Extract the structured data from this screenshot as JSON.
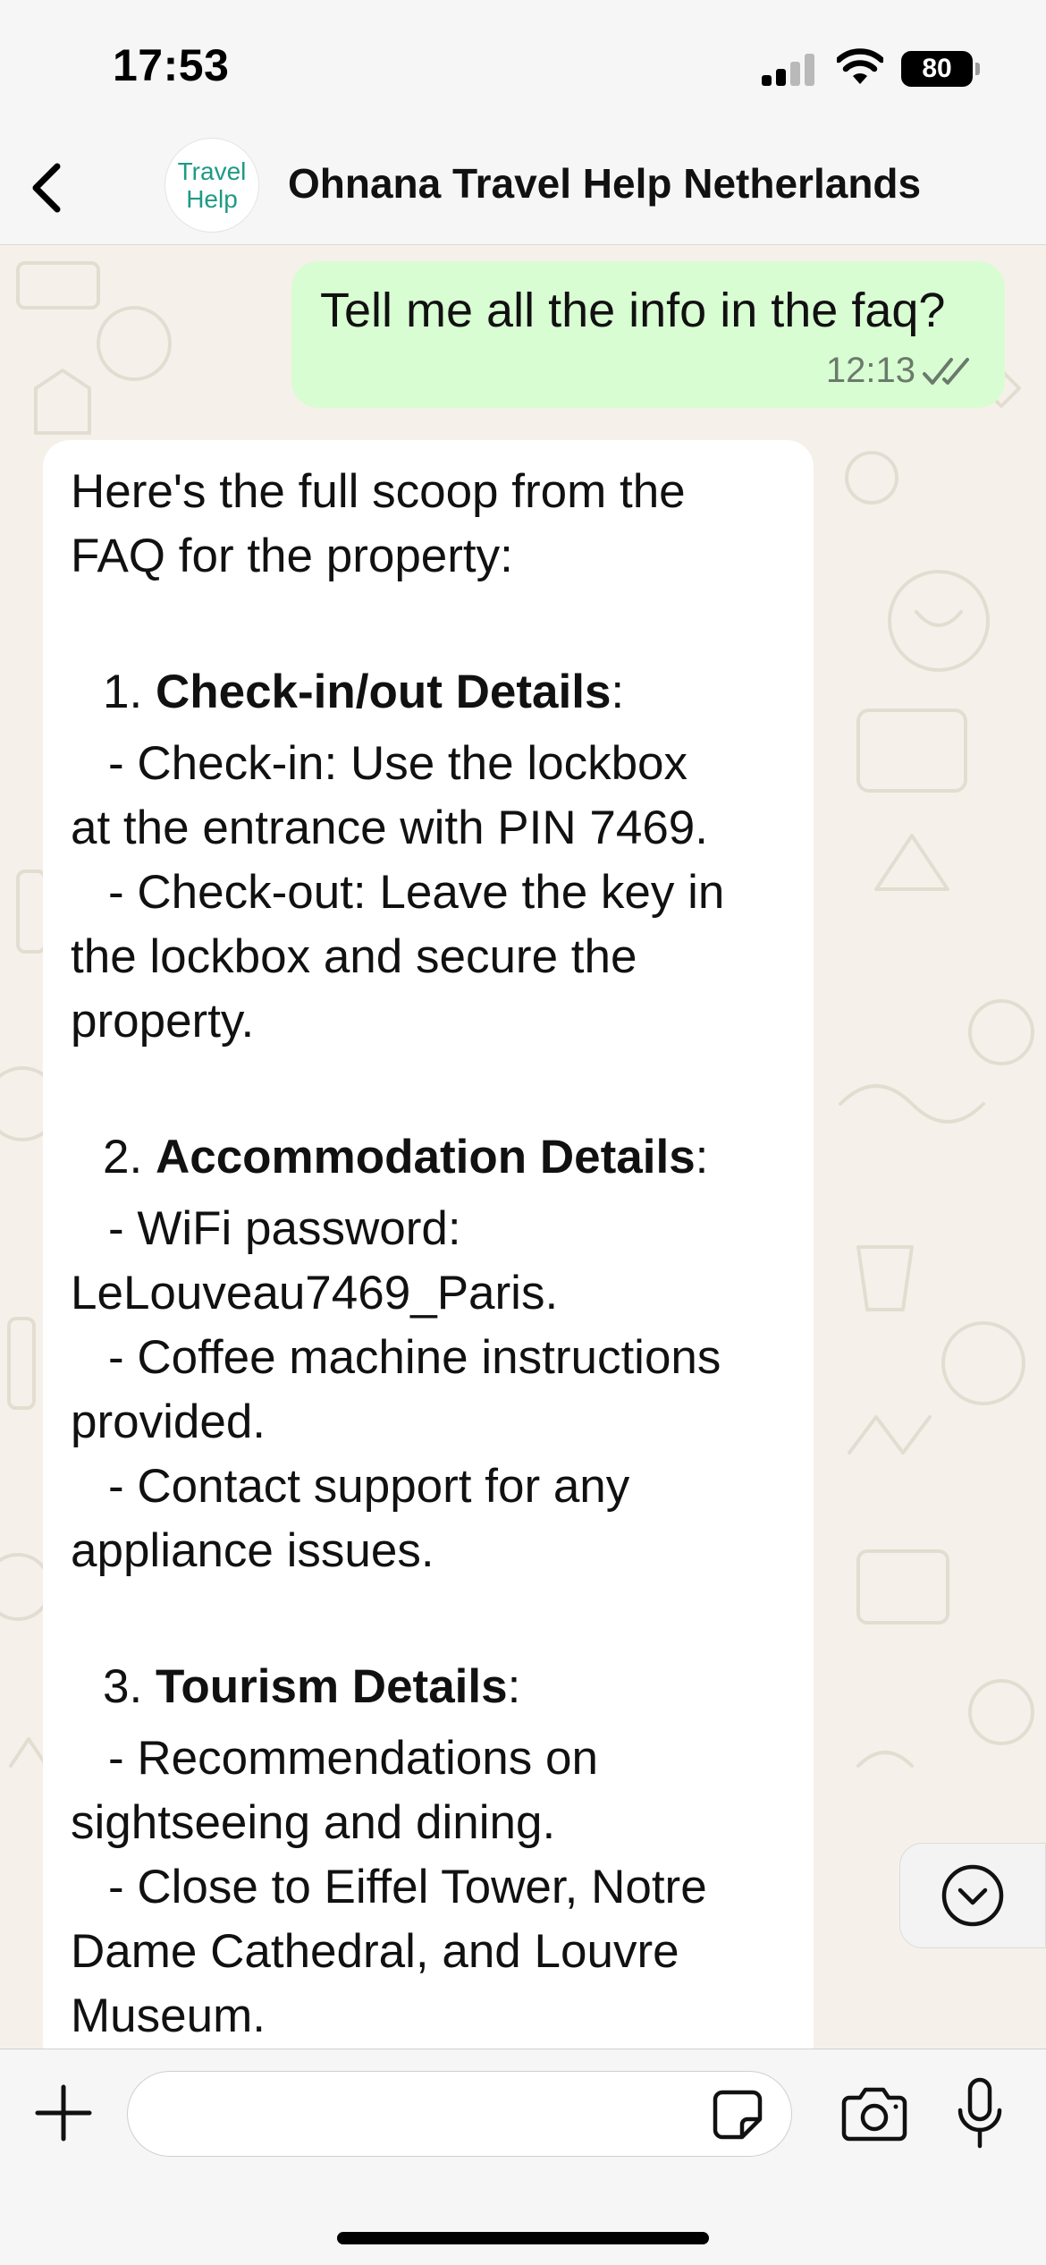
{
  "status_bar": {
    "time": "17:53",
    "battery": "80",
    "icons": [
      "signal-icon",
      "wifi-icon",
      "battery-icon"
    ]
  },
  "header": {
    "avatar_line1": "Travel",
    "avatar_line2": "Help",
    "contact_name": "Ohnana Travel Help Netherlands",
    "icons": [
      "chevron-left-icon"
    ],
    "accent_color": "#1e9a86"
  },
  "messages": {
    "outgoing": {
      "text": "Tell me all the info in the faq?",
      "time": "12:13",
      "status_icon": "double-check-icon",
      "bubble_color": "#d9fdd3"
    },
    "incoming": {
      "intro_1": "Here's the full scoop from the",
      "intro_2": "FAQ for the property:",
      "s1_num": "1.",
      "s1_title": "Check-in/out Details",
      "s1_suffix": ":",
      "s1_l1": "- Check-in: Use the lockbox",
      "s1_l2": "at the entrance with PIN 7469.",
      "s1_l3": "- Check-out: Leave the key in",
      "s1_l4": "the lockbox and secure the",
      "s1_l5": "property.",
      "s2_num": "2.",
      "s2_title": "Accommodation Details",
      "s2_suffix": ":",
      "s2_l1": "- WiFi password:",
      "s2_l2": "LeLouveau7469_Paris.",
      "s2_l3": "- Coffee machine instructions",
      "s2_l4": "provided.",
      "s2_l5": "- Contact support for any",
      "s2_l6": "appliance issues.",
      "s3_num": "3.",
      "s3_title": "Tourism Details",
      "s3_suffix": ":",
      "s3_l1": "- Recommendations on",
      "s3_l2": "sightseeing and dining.",
      "s3_l3": "- Close to Eiffel Tower, Notre",
      "s3_l4": "Dame Cathedral, and Louvre",
      "s3_l5": "Museum."
    }
  },
  "composer": {
    "placeholder": "",
    "icons": [
      "plus-icon",
      "sticker-icon",
      "camera-icon",
      "microphone-icon",
      "chevron-down-circle-icon"
    ]
  }
}
